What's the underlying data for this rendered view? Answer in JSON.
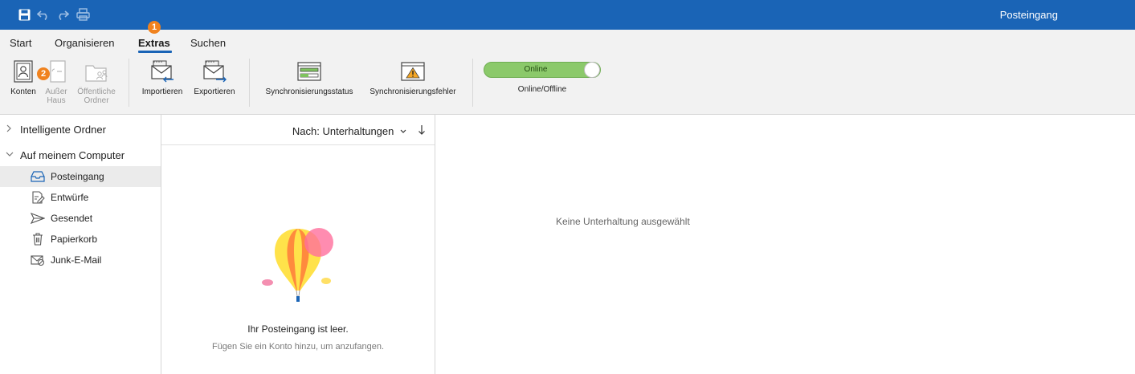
{
  "window": {
    "title": "Posteingang"
  },
  "tabs": [
    {
      "label": "Start"
    },
    {
      "label": "Organisieren"
    },
    {
      "label": "Extras"
    },
    {
      "label": "Suchen"
    }
  ],
  "badges": {
    "first": "1",
    "second": "2"
  },
  "ribbon": {
    "accounts": "Konten",
    "ooo": "Außer Haus",
    "public_folders": "Öffentliche Ordner",
    "import": "Importieren",
    "export": "Exportieren",
    "sync_status": "Synchronisierungsstatus",
    "sync_errors": "Synchronisierungsfehler",
    "online_state": "Online",
    "online_caption": "Online/Offline"
  },
  "sidebar": {
    "groups": [
      "Intelligente Ordner",
      "Auf meinem Computer"
    ],
    "folders": [
      "Posteingang",
      "Entwürfe",
      "Gesendet",
      "Papierkorb",
      "Junk-E-Mail"
    ]
  },
  "message_list": {
    "sort_label": "Nach: Unterhaltungen",
    "empty_title": "Ihr Posteingang ist leer.",
    "empty_subtitle": "Fügen Sie ein Konto hinzu, um anzufangen."
  },
  "reading_pane": {
    "message": "Keine Unterhaltung ausgewählt"
  },
  "colors": {
    "titlebar": "#1a64b6",
    "toggle_on": "#8bc96a",
    "badge": "#f0821e",
    "ribbon_bg": "#f2f2f2"
  }
}
